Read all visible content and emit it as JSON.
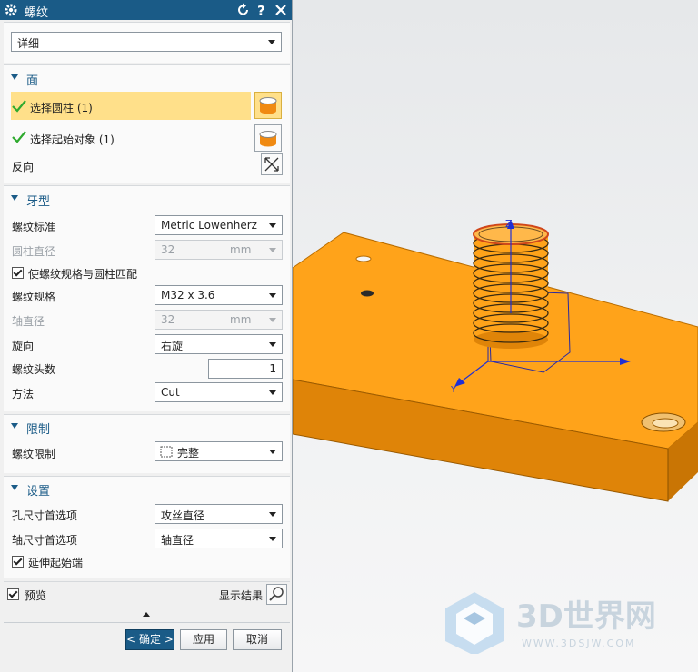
{
  "dialog": {
    "title": "螺纹",
    "type_select": "详细",
    "sections": {
      "face": {
        "label": "面",
        "select_cylinder": "选择圆柱 (1)",
        "select_start": "选择起始对象 (1)",
        "reverse": "反向"
      },
      "thread_type": {
        "label": "牙型",
        "standard_label": "螺纹标准",
        "standard_value": "Metric Lowenherz",
        "cyl_diameter_label": "圆柱直径",
        "cyl_diameter_value": "32",
        "cyl_diameter_unit": "mm",
        "match_checkbox": "使螺纹规格与圆柱匹配",
        "spec_label": "螺纹规格",
        "spec_value": "M32 x 3.6",
        "shaft_diameter_label": "轴直径",
        "shaft_diameter_value": "32",
        "shaft_diameter_unit": "mm",
        "hand_label": "旋向",
        "hand_value": "右旋",
        "starts_label": "螺纹头数",
        "starts_value": "1",
        "method_label": "方法",
        "method_value": "Cut"
      },
      "limits": {
        "label": "限制",
        "limit_label": "螺纹限制",
        "limit_value": "完整"
      },
      "settings": {
        "label": "设置",
        "hole_pref_label": "孔尺寸首选项",
        "hole_pref_value": "攻丝直径",
        "shaft_pref_label": "轴尺寸首选项",
        "shaft_pref_value": "轴直径",
        "extend_checkbox": "延伸起始端"
      }
    },
    "preview_label": "预览",
    "show_result_label": "显示结果",
    "buttons": {
      "ok": "< 确定 >",
      "apply": "应用",
      "cancel": "取消"
    }
  },
  "viewport": {
    "axis_labels": {
      "z": "Z",
      "y": "Y"
    },
    "watermark_text": "3D世界网",
    "watermark_url": "WWW.3DSJW.COM"
  },
  "colors": {
    "titlebar": "#1a5b87",
    "highlight_row": "#ffe08a",
    "model_orange": "#ffa31a",
    "axis_blue": "#1f2fd6"
  }
}
